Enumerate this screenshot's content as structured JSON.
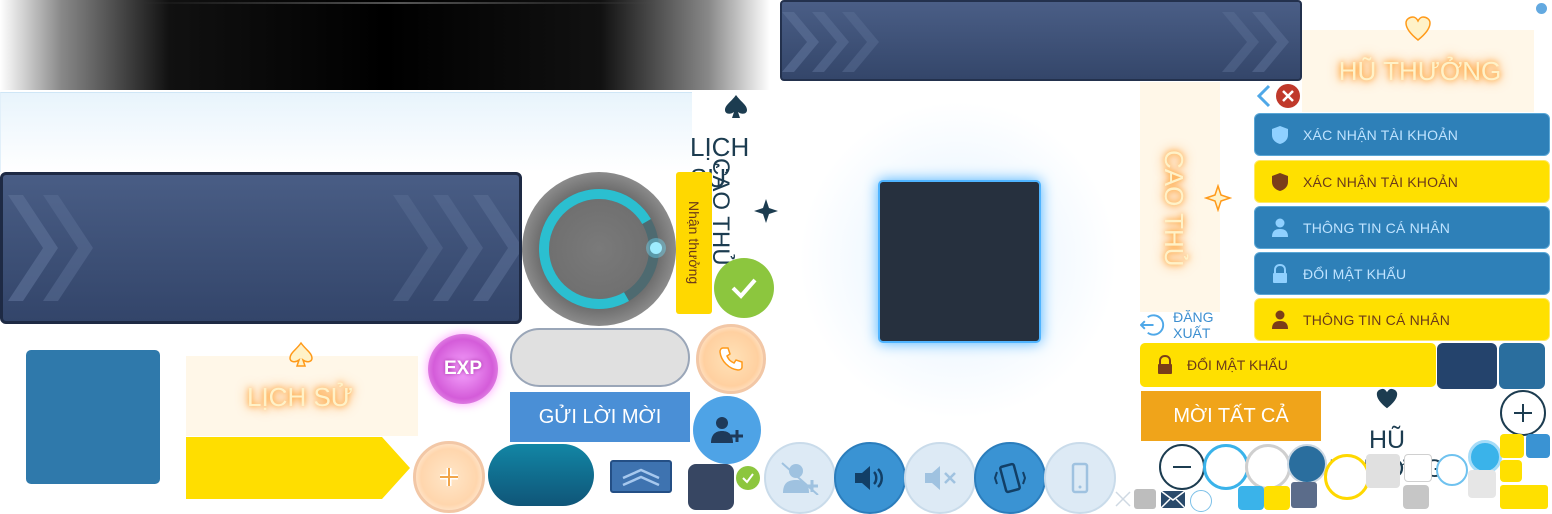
{
  "history_tab": {
    "title_dark": "LỊCH SỬ",
    "title_glow": "LỊCH SỬ"
  },
  "top_players": {
    "label_dark": "CAO THỦ",
    "label_glow": "CAO THỦ"
  },
  "jackpot": {
    "label_glow": "HŨ THƯỞNG",
    "label_dark": "HŨ THƯỞNG"
  },
  "claim_reward": {
    "label": "Nhận thưởng"
  },
  "invite": {
    "send_label": "GỬI LỜI MỜI",
    "invite_all_label": "MỜI TẤT CẢ"
  },
  "account_menu": {
    "items": [
      {
        "label": "XÁC NHẬN TÀI KHOẢN",
        "icon": "shield-icon"
      },
      {
        "label": "XÁC NHẬN TÀI KHOẢN",
        "icon": "shield-icon"
      },
      {
        "label": "THÔNG TIN CÁ NHÂN",
        "icon": "user-icon"
      },
      {
        "label": "ĐỔI MẬT KHẨU",
        "icon": "lock-icon"
      },
      {
        "label": "THÔNG TIN CÁ NHÂN",
        "icon": "user-icon"
      }
    ],
    "logout_label": "ĐĂNG XUẤT",
    "change_password_label": "ĐỔI MẬT KHẨU"
  },
  "badges": {
    "exp": "EXP"
  },
  "colors": {
    "navy_panel": "#3d4f72",
    "menu_blue": "#2e80b8",
    "menu_yellow": "#ffe000",
    "invite_blue": "#4a8fd6",
    "invite_orange": "#f0a41a",
    "glow_blue": "#4fb4ff"
  }
}
